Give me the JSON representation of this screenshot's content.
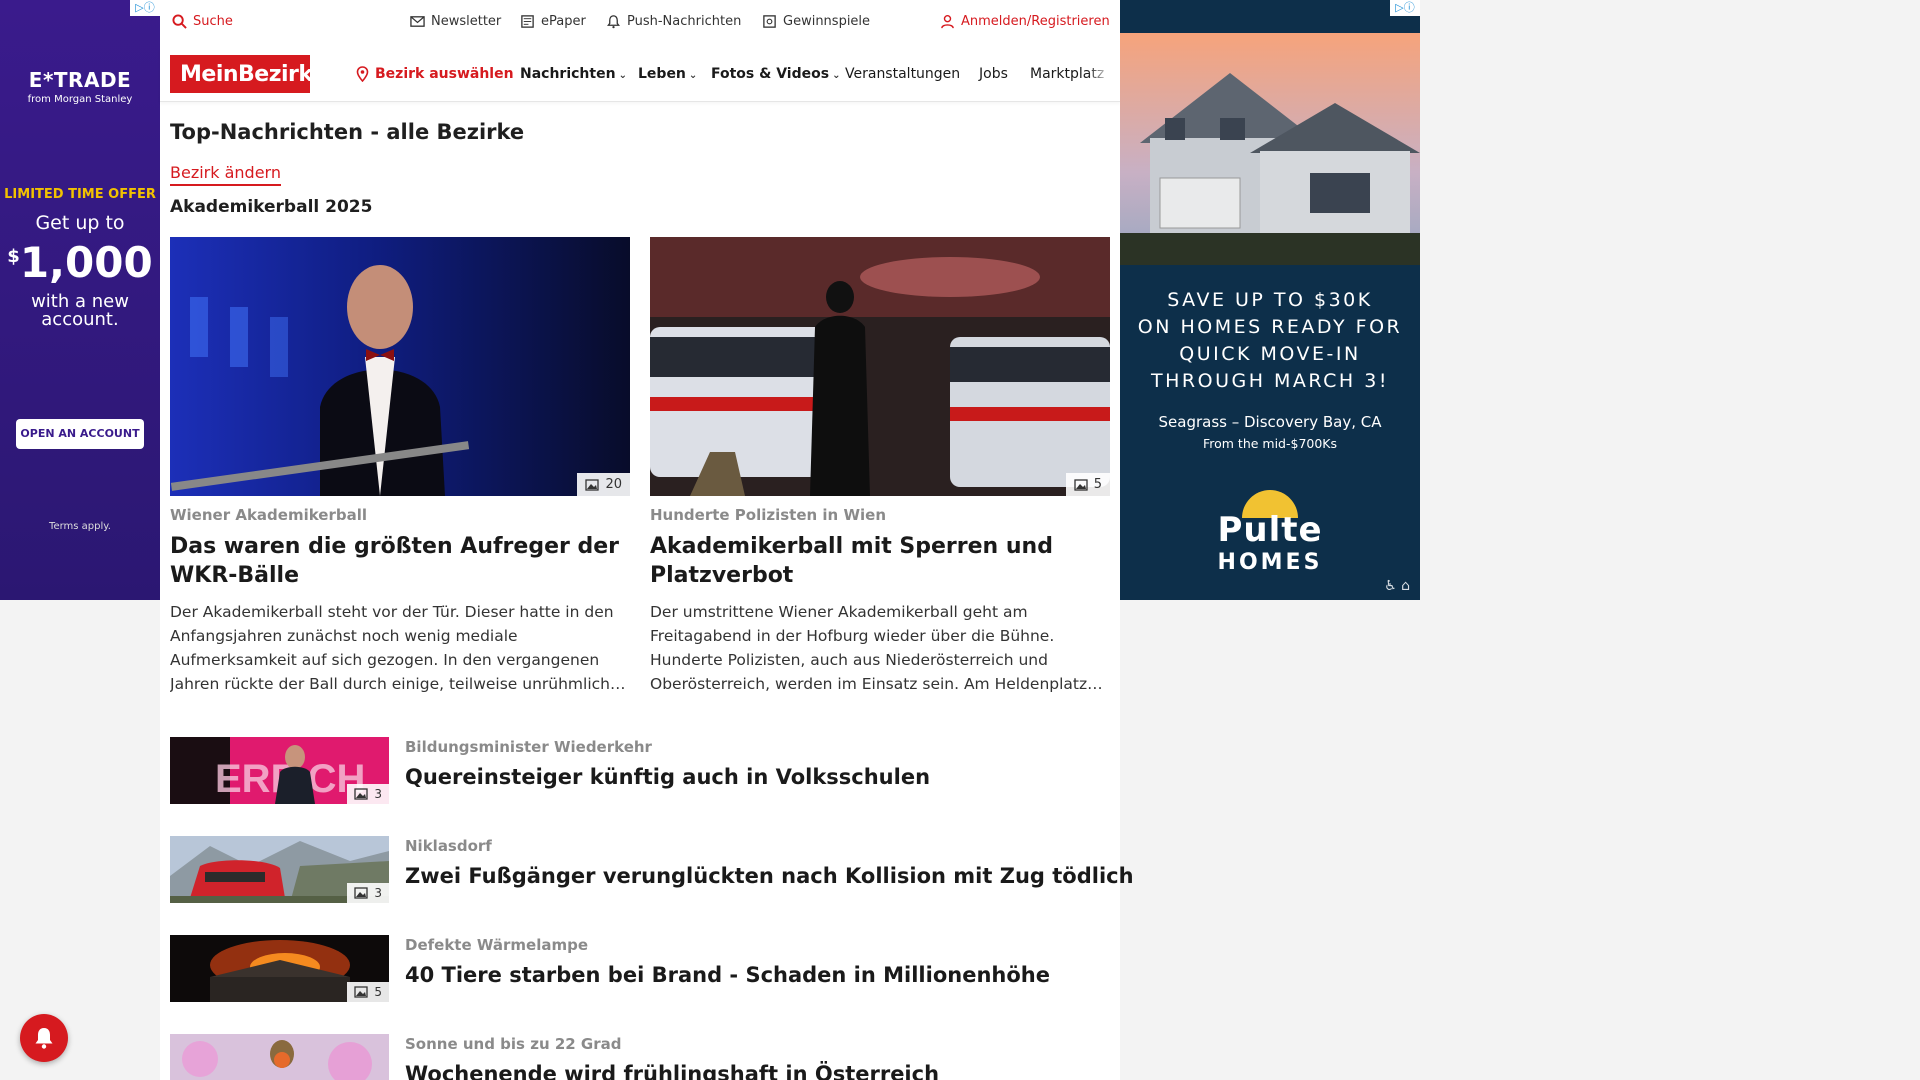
{
  "utility": {
    "search": "Suche",
    "newsletter": "Newsletter",
    "epaper": "ePaper",
    "push": "Push-Nachrichten",
    "gewinnspiele": "Gewinnspiele",
    "login": "Anmelden/Registrieren"
  },
  "nav": {
    "logo": "MeinBezirk",
    "bezirk": "Bezirk auswählen",
    "items": [
      "Nachrichten",
      "Leben",
      "Fotos & Videos",
      "Veranstaltungen",
      "Jobs",
      "Marktplatz"
    ]
  },
  "page": {
    "title": "Top-Nachrichten - alle Bezirke",
    "change_link": "Bezirk ändern",
    "section": "Akademikerball 2025"
  },
  "cards": [
    {
      "kicker": "Wiener Akademikerball",
      "title": "Das waren die größten Aufreger der WKR-Bälle",
      "text": "Der Akademikerball steht vor der Tür. Dieser hatte in den Anfangsjahren zunächst noch wenig mediale Aufmerksamkeit auf sich gezogen. In den vergangenen Jahren rückte der Ball durch einige, teilweise unrühmlich…",
      "photos": "20"
    },
    {
      "kicker": "Hunderte Polizisten in Wien",
      "title": "Akademikerball mit Sperren und Platzverbot",
      "text": "Der umstrittene Wiener Akademikerball geht am Freitagabend in der Hofburg wieder über die Bühne. Hunderte Polizisten, auch aus Niederösterreich und Oberösterreich, werden im Einsatz sein. Am Heldenplatz…",
      "photos": "5"
    }
  ],
  "list": [
    {
      "kicker": "Bildungsminister Wiederkehr",
      "title": "Quereinsteiger künftig auch in Volksschulen",
      "photos": "3"
    },
    {
      "kicker": "Niklasdorf",
      "title": "Zwei Fußgänger verunglückten nach Kollision mit Zug tödlich",
      "photos": "3"
    },
    {
      "kicker": "Defekte Wärmelampe",
      "title": "40 Tiere starben bei Brand - Schaden in Millionenhöhe",
      "photos": "5"
    },
    {
      "kicker": "Sonne und bis zu 22 Grad",
      "title": "Wochenende wird frühlingshaft in Österreich",
      "photos": ""
    }
  ],
  "ad_left": {
    "brand": "E*TRADE",
    "brand_sub": "from Morgan Stanley",
    "offer": "LIMITED TIME OFFER",
    "get": "Get up to",
    "currency": "$",
    "amount": "1,000",
    "with": "with a new account.",
    "button": "OPEN AN ACCOUNT",
    "terms": "Terms apply."
  },
  "ad_right": {
    "headline_lines": [
      "SAVE UP TO $30K",
      "ON HOMES READY FOR",
      "QUICK MOVE-IN",
      "THROUGH MARCH 3!"
    ],
    "location": "Seagrass – Discovery Bay, CA",
    "price": "From the mid-$700Ks",
    "brand": "Pulte",
    "brand_sub": "HOMES"
  }
}
